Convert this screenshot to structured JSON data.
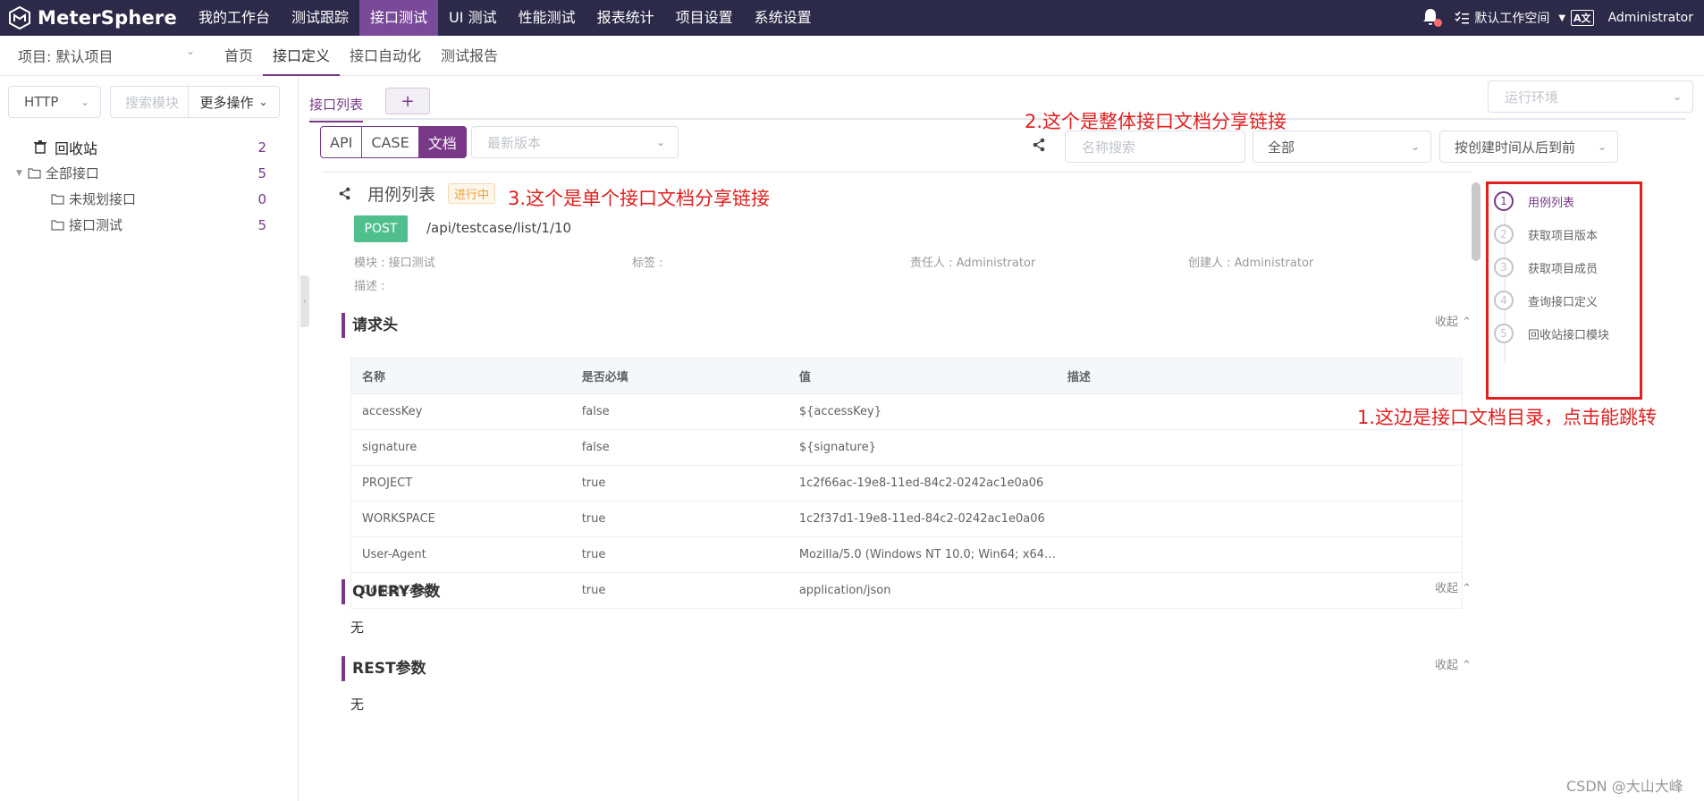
{
  "app": {
    "name": "MeterSphere"
  },
  "nav": {
    "items": [
      "我的工作台",
      "测试跟踪",
      "接口测试",
      "UI 测试",
      "性能测试",
      "报表统计",
      "项目设置",
      "系统设置"
    ],
    "active_index": 2
  },
  "top_right": {
    "workspace": "默认工作空间",
    "user": "Administrator"
  },
  "subheader": {
    "project": "项目: 默认项目",
    "tabs": [
      "首页",
      "接口定义",
      "接口自动化",
      "测试报告"
    ],
    "active_index": 1
  },
  "sidebar": {
    "protocol": "HTTP",
    "search_placeholder": "搜索模块",
    "more_label": "更多操作",
    "tree": [
      {
        "label": "回收站",
        "count": "2"
      },
      {
        "label": "全部接口",
        "count": "5"
      },
      {
        "label": "未规划接口",
        "count": "0"
      },
      {
        "label": "接口测试",
        "count": "5"
      }
    ]
  },
  "main": {
    "tab_label": "接口列表",
    "add_label": "+",
    "env_placeholder": "运行环境",
    "mode_buttons": [
      "API",
      "CASE",
      "文档"
    ],
    "active_mode": 2,
    "version_placeholder": "最新版本",
    "name_search_placeholder": "名称搜索",
    "filter_all": "全部",
    "sort_label": "按创建时间从后到前"
  },
  "doc": {
    "title": "用例列表",
    "status": "进行中",
    "method": "POST",
    "path": "/api/testcase/list/1/10",
    "meta": {
      "module": "模块 : 接口测试",
      "tags": "标签 :",
      "owner": "责任人 : Administrator",
      "creator": "创建人 : Administrator",
      "desc": "描述 :"
    },
    "collapse_label": "收起",
    "sections": {
      "headers_title": "请求头",
      "query_title": "QUERY参数",
      "rest_title": "REST参数",
      "none": "无"
    },
    "table": {
      "columns": [
        "名称",
        "是否必填",
        "值",
        "描述"
      ],
      "rows": [
        [
          "accessKey",
          "false",
          "${accessKey}",
          ""
        ],
        [
          "signature",
          "false",
          "${signature}",
          ""
        ],
        [
          "PROJECT",
          "true",
          "1c2f66ac-19e8-11ed-84c2-0242ac1e0a06",
          ""
        ],
        [
          "WORKSPACE",
          "true",
          "1c2f37d1-19e8-11ed-84c2-0242ac1e0a06",
          ""
        ],
        [
          "User-Agent",
          "true",
          "Mozilla/5.0 (Windows NT 10.0; Win64; x64) A...",
          ""
        ],
        [
          "Content-Type",
          "true",
          "application/json",
          ""
        ]
      ]
    }
  },
  "toc": {
    "items": [
      {
        "num": "1",
        "label": "用例列表"
      },
      {
        "num": "2",
        "label": "获取项目版本"
      },
      {
        "num": "3",
        "label": "获取项目成员"
      },
      {
        "num": "4",
        "label": "查询接口定义"
      },
      {
        "num": "5",
        "label": "回收站接口模块"
      }
    ],
    "active_index": 0
  },
  "annotations": {
    "a1": "1.这边是接口文档目录，点击能跳转",
    "a2": "2.这个是整体接口文档分享链接",
    "a3": "3.这个是单个接口文档分享链接"
  },
  "watermark": "CSDN @大山大峰",
  "colors": {
    "topbar": "#2c2a48",
    "accent": "#783887",
    "annotation": "#e02020",
    "post": "#4fc08d"
  }
}
